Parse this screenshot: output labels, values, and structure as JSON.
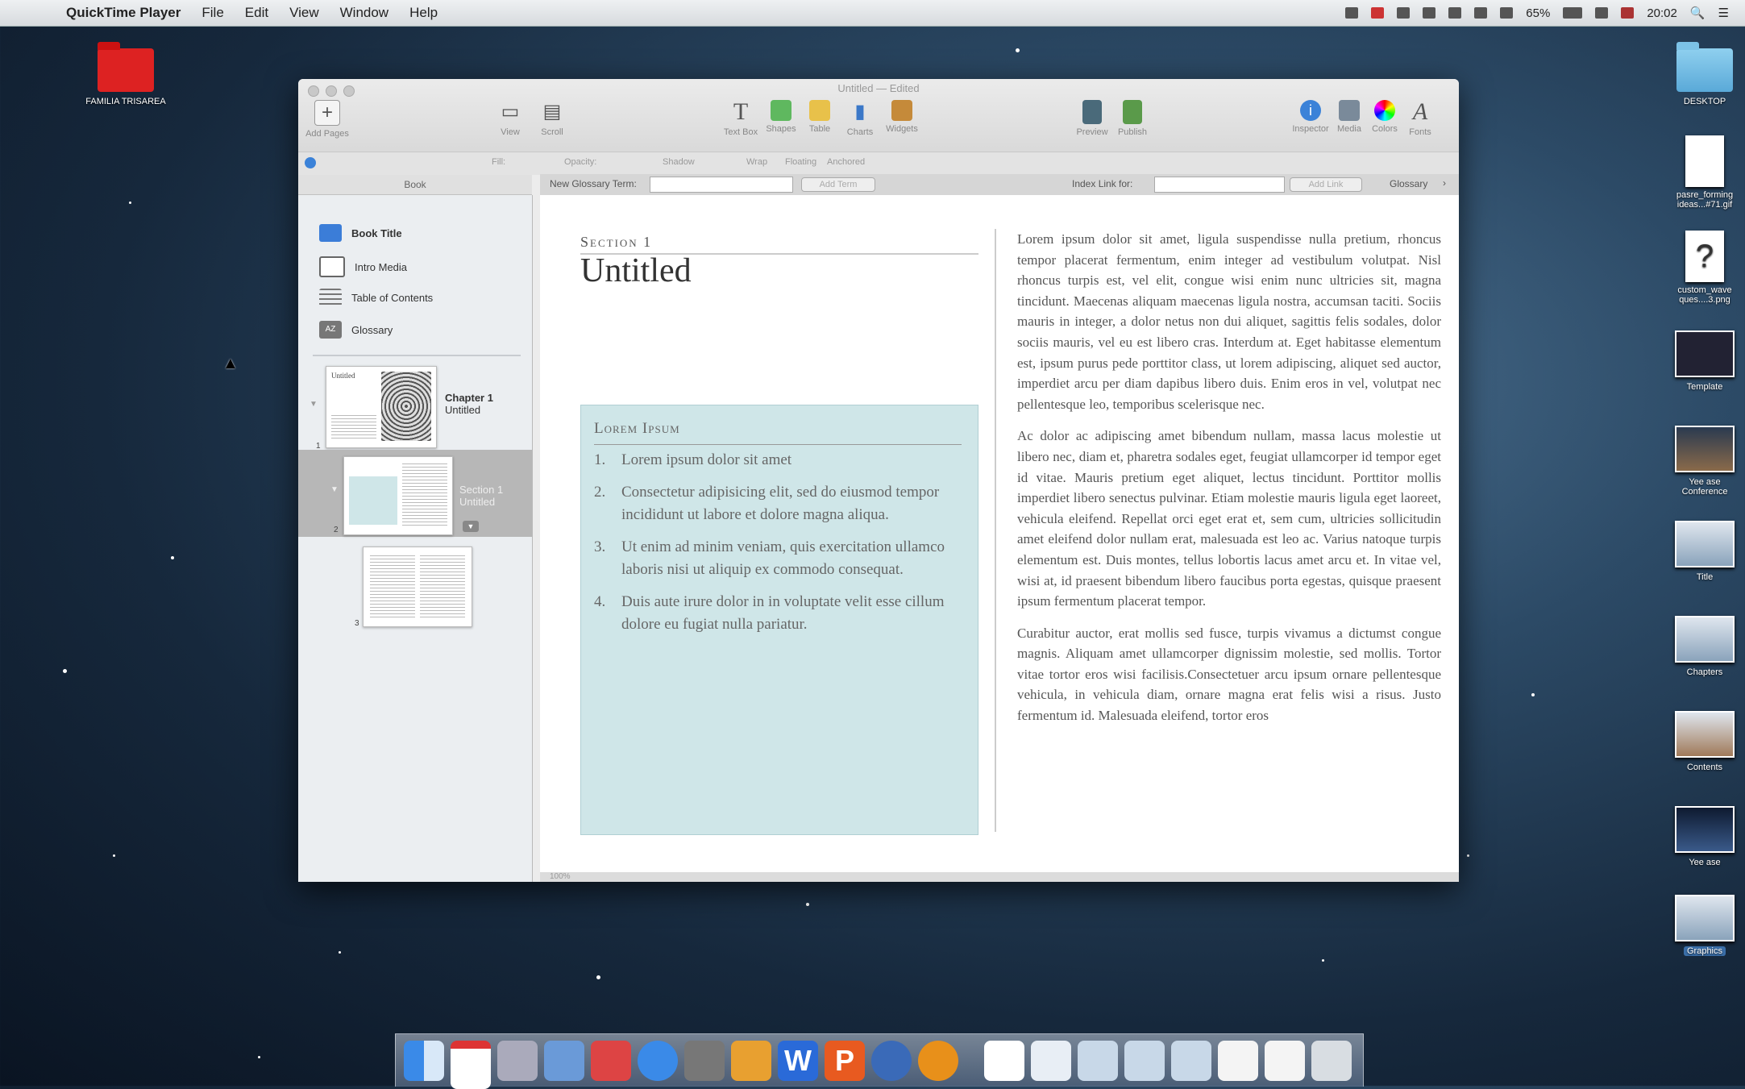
{
  "menubar": {
    "app": "QuickTime Player",
    "menus": [
      "File",
      "Edit",
      "View",
      "Window",
      "Help"
    ],
    "battery": "65%",
    "clock": "20:02"
  },
  "desktop": {
    "left_icons": [
      {
        "label": "FAMILIA TRISAREA"
      }
    ],
    "right_icons": [
      {
        "label": "DESKTOP"
      },
      {
        "label": "pasre_forming\nideas...#71.gif"
      },
      {
        "label": "custom_wave\nques....3.png"
      },
      {
        "label": "Template"
      },
      {
        "label": "Yee ase\nConference"
      },
      {
        "label": "Title"
      },
      {
        "label": "Chapters"
      },
      {
        "label": "Contents"
      },
      {
        "label": "Yee ase"
      },
      {
        "label": "Graphics"
      }
    ]
  },
  "window": {
    "title": "Untitled — Edited",
    "toolbar": {
      "add_pages": "Add Pages",
      "view": "View",
      "scroll": "Scroll",
      "text_box": "Text Box",
      "shapes": "Shapes",
      "table": "Table",
      "charts": "Charts",
      "widgets": "Widgets",
      "preview": "Preview",
      "publish": "Publish",
      "inspector": "Inspector",
      "media": "Media",
      "colors": "Colors",
      "fonts": "Fonts"
    },
    "formatbar": {
      "fill": "Fill:",
      "opacity": "Opacity:",
      "shadow": "Shadow",
      "wrap": "Wrap",
      "floating": "Floating",
      "anchored": "Anchored"
    },
    "glossary_bar": {
      "new_term_label": "New Glossary Term:",
      "add_term": "Add Term",
      "index_link_label": "Index Link for:",
      "add_link": "Add Link",
      "glossary": "Glossary"
    },
    "sidebar": {
      "header": "Book",
      "items": [
        {
          "label": "Book Title",
          "icon": "book-title-icon"
        },
        {
          "label": "Intro Media",
          "icon": "intro-media-icon"
        },
        {
          "label": "Table of Contents",
          "icon": "toc-icon"
        },
        {
          "label": "Glossary",
          "icon": "glossary-icon"
        }
      ],
      "chapter": {
        "title": "Chapter 1",
        "subtitle": "Untitled",
        "thumb_title": "Untitled"
      },
      "section": {
        "title": "Section 1",
        "subtitle": "Untitled"
      },
      "page_numbers": [
        "1",
        "2",
        "3"
      ]
    },
    "document": {
      "section_label": "Section 1",
      "title": "Untitled",
      "sidebar_box": {
        "heading": "Lorem Ipsum",
        "items": [
          {
            "n": "1.",
            "text": "Lorem ipsum dolor sit amet"
          },
          {
            "n": "2.",
            "text": "Consectetur adipisicing elit, sed do eiusmod tempor incididunt ut labore et dolore magna aliqua."
          },
          {
            "n": "3.",
            "text": "Ut enim ad minim veniam, quis exercitation ullamco laboris nisi ut aliquip ex commodo consequat."
          },
          {
            "n": "4.",
            "text": "Duis aute irure dolor in in voluptate velit esse cillum dolore eu fugiat nulla pariatur."
          }
        ]
      },
      "paragraphs": [
        "Lorem ipsum dolor sit amet, ligula suspendisse nulla pretium, rhoncus tempor placerat fermentum, enim integer ad vestibulum volutpat. Nisl rhoncus turpis est, vel elit, congue wisi enim nunc ultricies sit, magna tincidunt. Maecenas aliquam maecenas ligula nostra, accumsan taciti. Sociis mauris in integer, a dolor netus non dui aliquet, sagittis felis sodales, dolor sociis mauris, vel eu est libero cras. Interdum at. Eget habitasse elementum est, ipsum purus pede porttitor class, ut lorem adipiscing, aliquet sed auctor, imperdiet arcu per diam dapibus libero duis. Enim eros in vel, volutpat nec pellentesque leo, temporibus scelerisque nec.",
        "Ac dolor ac adipiscing amet bibendum nullam, massa lacus molestie ut libero nec, diam et, pharetra sodales eget, feugiat ullamcorper id tempor eget id vitae. Mauris pretium eget aliquet, lectus tincidunt. Porttitor mollis imperdiet libero senectus pulvinar. Etiam molestie mauris ligula eget laoreet, vehicula eleifend. Repellat orci eget erat et, sem cum, ultricies sollicitudin amet eleifend dolor nullam erat, malesuada est leo ac. Varius natoque turpis elementum est. Duis montes, tellus lobortis lacus amet arcu et. In vitae vel, wisi at, id praesent bibendum libero faucibus porta egestas, quisque praesent ipsum fermentum placerat tempor.",
        "Curabitur auctor, erat mollis sed fusce, turpis vivamus a dictumst congue magnis. Aliquam amet ullamcorper dignissim molestie, sed mollis. Tortor vitae tortor eros wisi facilisis.Consectetuer arcu ipsum ornare pellentesque vehicula, in vehicula diam, ornare magna erat felis wisi a risus. Justo fermentum id. Malesuada eleifend, tortor eros"
      ]
    },
    "statusbar": {
      "zoom": "100%"
    }
  }
}
